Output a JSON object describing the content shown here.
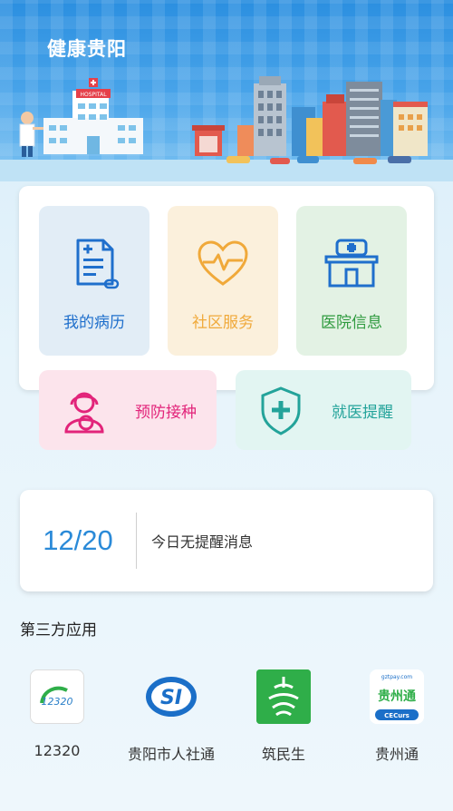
{
  "header": {
    "title": "健康贵阳",
    "hospital_sign": "HOSPITAL"
  },
  "main_tiles": [
    {
      "label": "我的病历",
      "icon": "medical-record-icon",
      "color": "#1f6fcc"
    },
    {
      "label": "社区服务",
      "icon": "heart-pulse-icon",
      "color": "#f0a93a"
    },
    {
      "label": "医院信息",
      "icon": "hospital-building-icon",
      "color": "#2e9a3e"
    }
  ],
  "wide_tiles": [
    {
      "label": "预防接种",
      "icon": "mother-baby-icon",
      "color": "#e2247a"
    },
    {
      "label": "就医提醒",
      "icon": "shield-plus-icon",
      "color": "#23a39a"
    }
  ],
  "reminder": {
    "date": "12/20",
    "message": "今日无提醒消息"
  },
  "third_party": {
    "title": "第三方应用",
    "apps": [
      {
        "label": "12320",
        "icon": "12320-logo-icon",
        "logo_text": "12320"
      },
      {
        "label": "贵阳市人社通",
        "icon": "si-logo-icon",
        "logo_text": "SI"
      },
      {
        "label": "筑民生",
        "icon": "zhuminsheng-logo-icon"
      },
      {
        "label": "贵州通",
        "icon": "guizhoutong-logo-icon",
        "logo_text": "贵州通",
        "logo_top": "gztpay.com",
        "logo_bottom": "CECurs"
      }
    ]
  }
}
